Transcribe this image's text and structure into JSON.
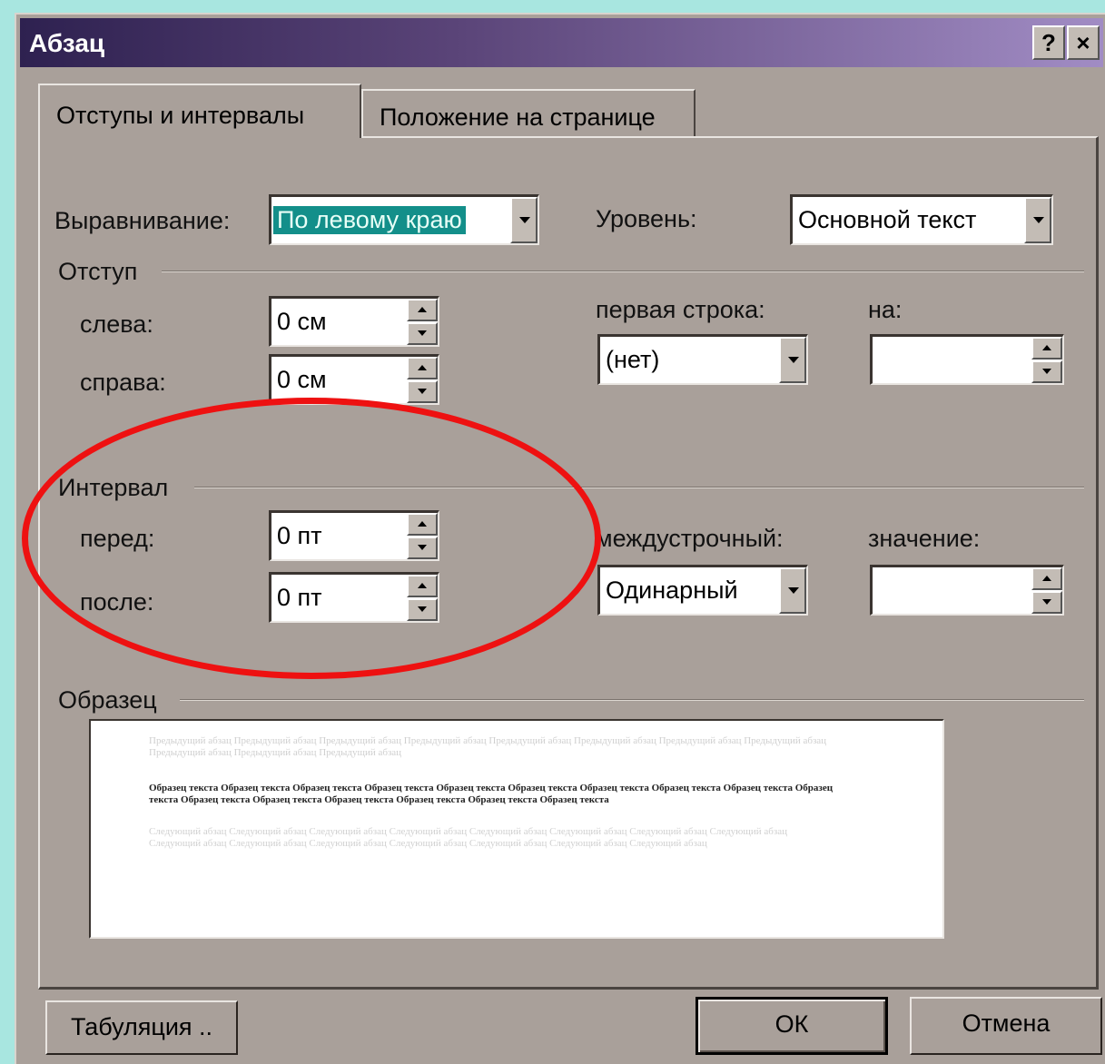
{
  "window": {
    "title": "Абзац",
    "help_button": "?",
    "close_button": "×"
  },
  "tabs": [
    {
      "label": "Отступы и интервалы",
      "active": true
    },
    {
      "label": "Положение на странице",
      "active": false
    }
  ],
  "alignment": {
    "label": "Выравнивание:",
    "value": "По левому краю"
  },
  "level": {
    "label": "Уровень:",
    "value": "Основной текст"
  },
  "indent": {
    "group_label": "Отступ",
    "left_label": "слева:",
    "left_value": "0 см",
    "right_label": "справа:",
    "right_value": "0 см",
    "first_line_label": "первая строка:",
    "first_line_value": "(нет)",
    "by_label": "на:",
    "by_value": ""
  },
  "spacing": {
    "group_label": "Интервал",
    "before_label": "перед:",
    "before_value": "0 пт",
    "after_label": "после:",
    "after_value": "0 пт",
    "line_spacing_label": "междустрочный:",
    "line_spacing_value": "Одинарный",
    "at_label": "значение:",
    "at_value": ""
  },
  "preview": {
    "group_label": "Образец",
    "previous_text": "Предыдущий абзац Предыдущий абзац Предыдущий абзац Предыдущий абзац Предыдущий абзац Предыдущий абзац Предыдущий абзац Предыдущий абзац Предыдущий абзац Предыдущий абзац Предыдущий абзац",
    "sample_text": "Образец текста Образец текста Образец текста Образец текста Образец текста Образец текста Образец текста Образец текста Образец текста Образец текста Образец текста Образец текста Образец текста Образец текста Образец текста Образец текста",
    "next_text": "Следующий абзац Следующий абзац Следующий абзац Следующий абзац Следующий абзац Следующий абзац Следующий абзац Следующий абзац Следующий абзац Следующий абзац Следующий абзац Следующий абзац Следующий абзац Следующий абзац Следующий абзац"
  },
  "buttons": {
    "tabs": "Табуляция ..",
    "ok": "ОК",
    "cancel": "Отмена"
  },
  "colors": {
    "dialog_bg": "#a9a09a",
    "selection": "#138f8a",
    "highlight_ellipse": "#ee1111",
    "desktop": "#a8e6e0"
  }
}
